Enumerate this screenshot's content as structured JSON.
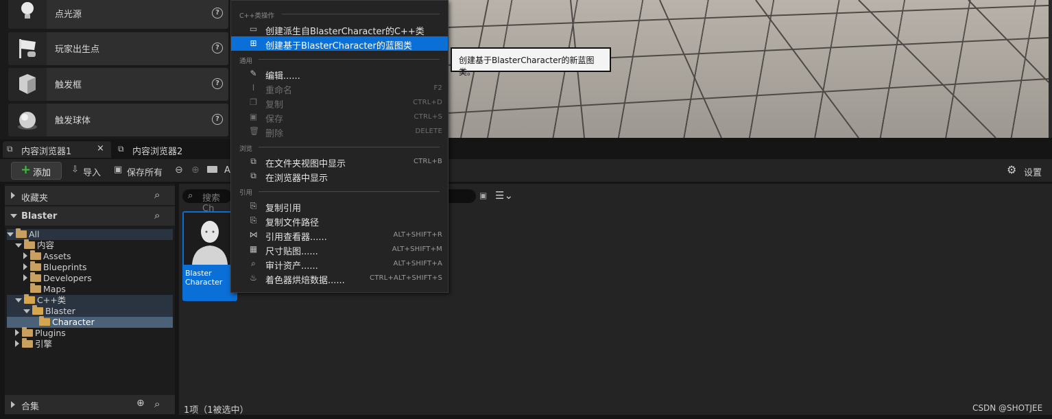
{
  "place_actors": {
    "items": [
      {
        "label": "点光源",
        "icon": "point-light-icon"
      },
      {
        "label": "玩家出生点",
        "icon": "player-start-icon"
      },
      {
        "label": "触发框",
        "icon": "trigger-box-icon"
      },
      {
        "label": "触发球体",
        "icon": "trigger-sphere-icon"
      }
    ],
    "help_glyph": "?"
  },
  "tabs": [
    {
      "label": "内容浏览器1",
      "close": "×"
    },
    {
      "label": "内容浏览器2"
    }
  ],
  "toolbar": {
    "add_label": "添加",
    "import_label": "导入",
    "save_all_label": "保存所有",
    "path_text": "A",
    "settings_label": "设置"
  },
  "sources": {
    "favorites_label": "收藏夹",
    "project_label": "Blaster",
    "collections_label": "合集",
    "tree": {
      "all": "All",
      "content": "内容",
      "assets": "Assets",
      "blueprints": "Blueprints",
      "developers": "Developers",
      "maps": "Maps",
      "cpp_classes": "C++类",
      "blaster": "Blaster",
      "character": "Character",
      "plugins": "Plugins",
      "engine": "引擎"
    }
  },
  "assets": {
    "search_placeholder": "搜索 Ch",
    "tile_label": "Blaster Character",
    "status": "1项（1被选中）"
  },
  "context_menu": {
    "sections": {
      "cpp": "C++类操作",
      "common": "通用",
      "browse": "浏览",
      "references": "引用"
    },
    "items": {
      "create_derived_cpp": {
        "label": "创建派生自BlasterCharacter的C++类",
        "shortcut": ""
      },
      "create_blueprint": {
        "label": "创建基于BlasterCharacter的蓝图类",
        "shortcut": ""
      },
      "edit": {
        "label": "编辑......",
        "shortcut": ""
      },
      "rename": {
        "label": "重命名",
        "shortcut": "F2"
      },
      "duplicate": {
        "label": "复制",
        "shortcut": "CTRL+D"
      },
      "save": {
        "label": "保存",
        "shortcut": "CTRL+S"
      },
      "delete": {
        "label": "删除",
        "shortcut": "DELETE"
      },
      "show_in_folder": {
        "label": "在文件夹视图中显示",
        "shortcut": "CTRL+B"
      },
      "show_in_browser": {
        "label": "在浏览器中显示",
        "shortcut": ""
      },
      "copy_reference": {
        "label": "复制引用",
        "shortcut": ""
      },
      "copy_file_path": {
        "label": "复制文件路径",
        "shortcut": ""
      },
      "reference_viewer": {
        "label": "引用查看器......",
        "shortcut": "ALT+SHIFT+R"
      },
      "size_map": {
        "label": "尺寸贴图......",
        "shortcut": "ALT+SHIFT+M"
      },
      "audit_assets": {
        "label": "审计资产......",
        "shortcut": "ALT+SHIFT+A"
      },
      "shader_cook": {
        "label": "着色器烘焙数据......",
        "shortcut": "CTRL+ALT+SHIFT+S"
      }
    }
  },
  "tooltip": "创建基于BlasterCharacter的新蓝图类。",
  "watermark": "CSDN @SHOTJEE",
  "colors": {
    "accent": "#0a6fd6",
    "menu_bg": "#242424",
    "panel_bg": "#1c1c1c"
  }
}
